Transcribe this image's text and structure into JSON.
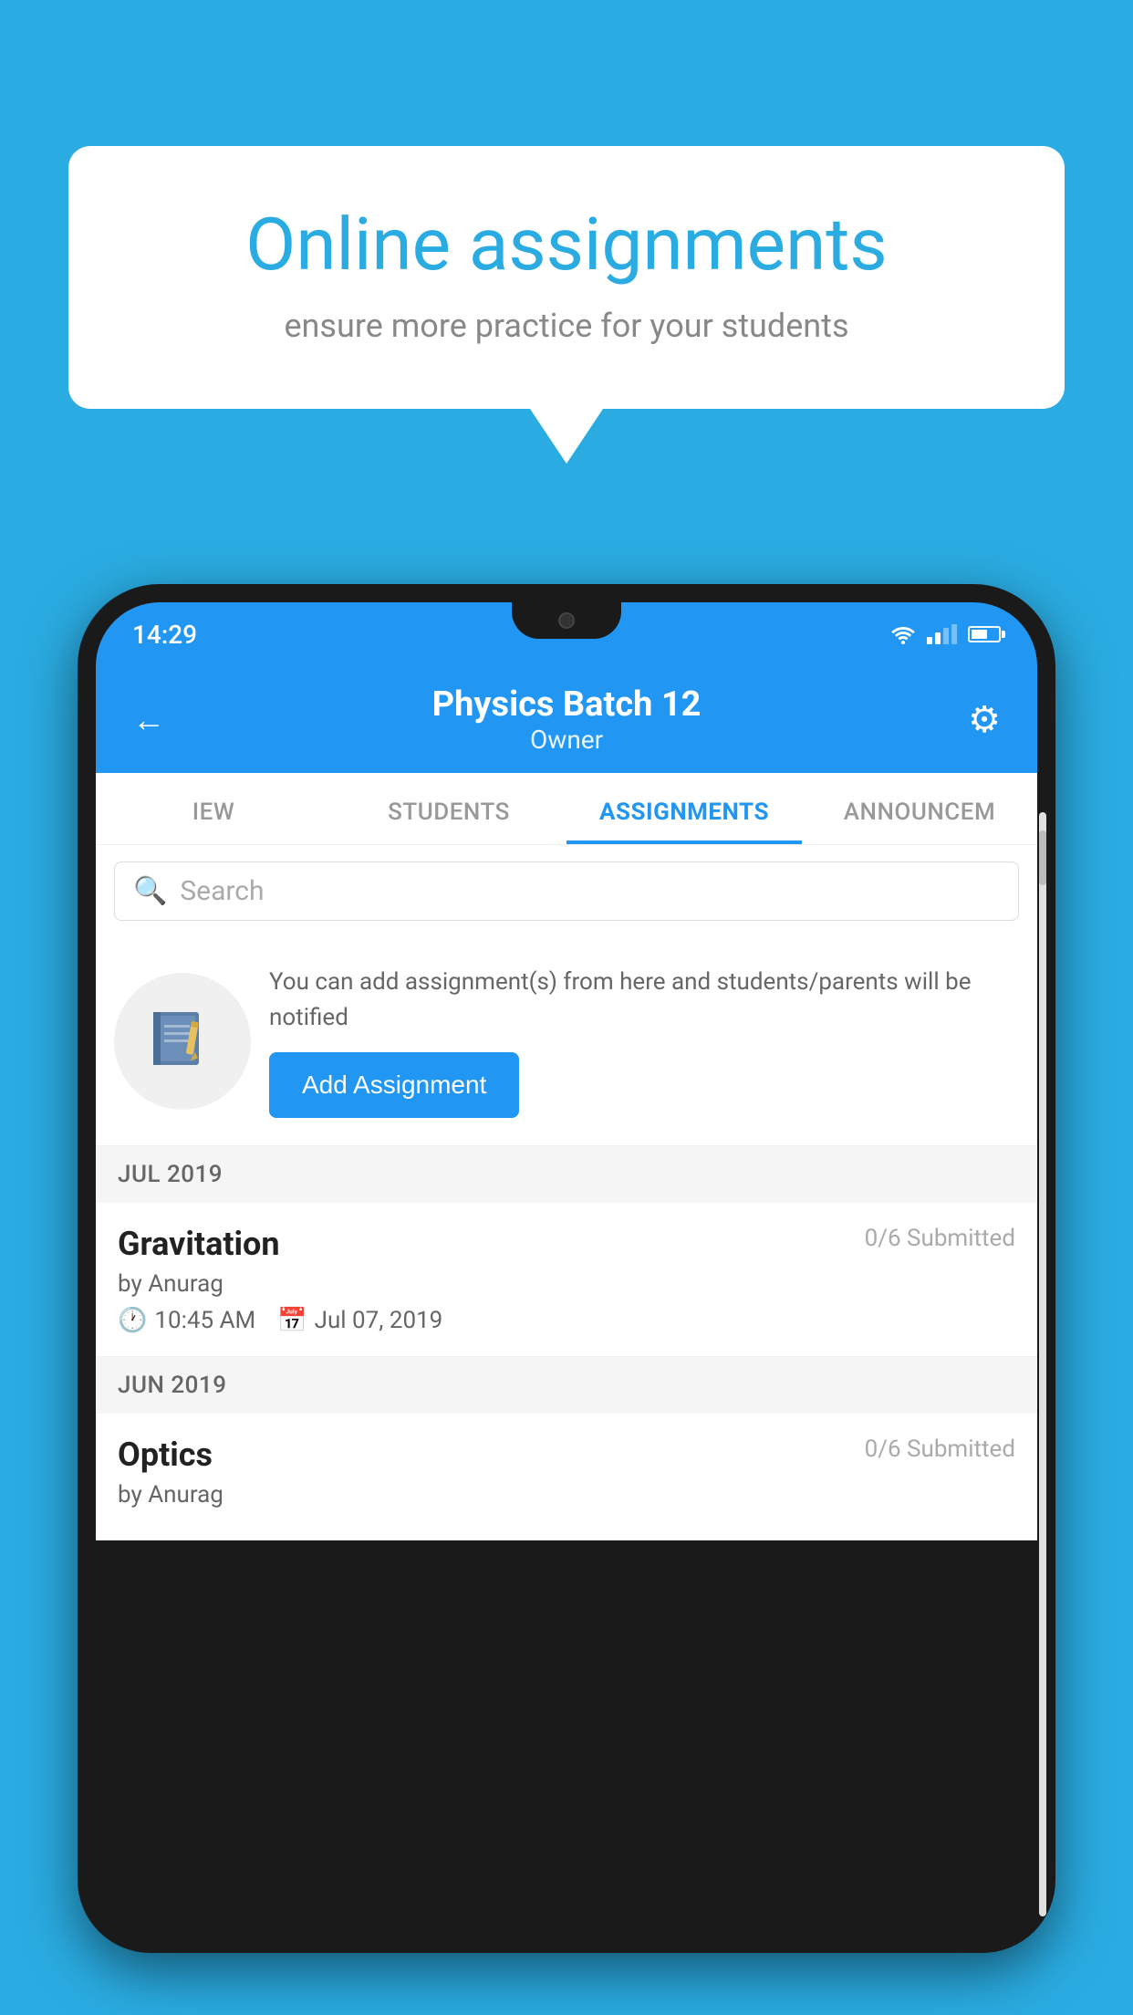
{
  "background_color": "#00AADD",
  "speech_bubble": {
    "title": "Online assignments",
    "subtitle": "ensure more practice for your students"
  },
  "phone": {
    "status_bar": {
      "time": "14:29"
    },
    "header": {
      "title": "Physics Batch 12",
      "subtitle": "Owner",
      "back_label": "←",
      "settings_label": "⚙"
    },
    "tabs": [
      {
        "label": "IEW",
        "active": false
      },
      {
        "label": "STUDENTS",
        "active": false
      },
      {
        "label": "ASSIGNMENTS",
        "active": true
      },
      {
        "label": "ANNOUNCEM",
        "active": false
      }
    ],
    "search": {
      "placeholder": "Search"
    },
    "promo": {
      "description": "You can add assignment(s) from here and students/parents will be notified",
      "button_label": "Add Assignment"
    },
    "sections": [
      {
        "header": "JUL 2019",
        "assignments": [
          {
            "name": "Gravitation",
            "submitted": "0/6 Submitted",
            "by": "by Anurag",
            "time": "10:45 AM",
            "date": "Jul 07, 2019"
          }
        ]
      },
      {
        "header": "JUN 2019",
        "assignments": [
          {
            "name": "Optics",
            "submitted": "0/6 Submitted",
            "by": "by Anurag",
            "time": "",
            "date": ""
          }
        ]
      }
    ]
  }
}
